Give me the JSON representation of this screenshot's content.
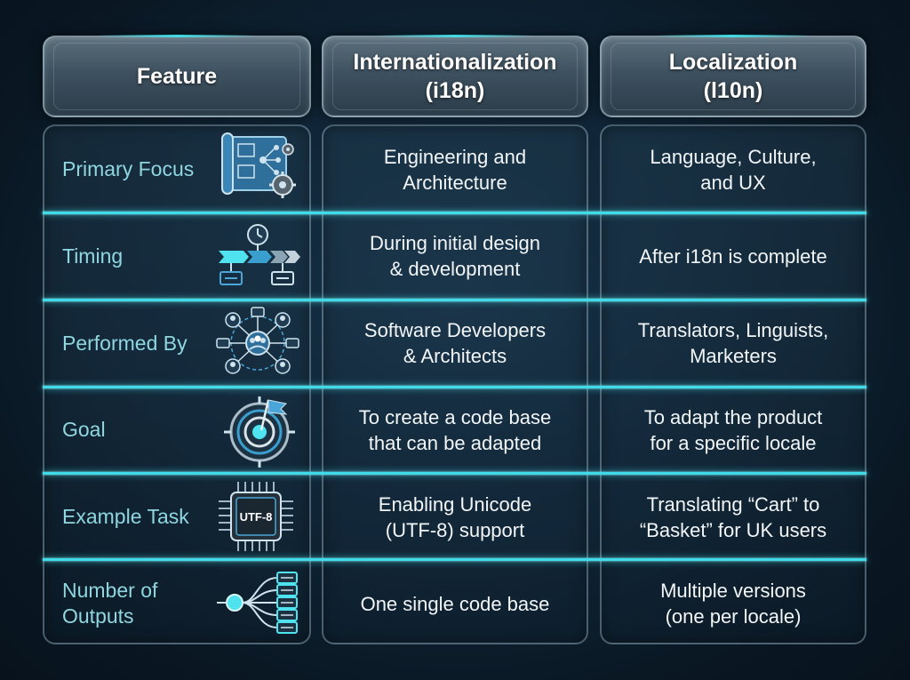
{
  "table": {
    "headers": [
      {
        "title": "Feature",
        "sub": ""
      },
      {
        "title": "Internationalization",
        "sub": "(i18n)"
      },
      {
        "title": "Localization",
        "sub": "(l10n)"
      }
    ],
    "rows": [
      {
        "feature": [
          "Primary Focus",
          ""
        ],
        "icon": "blueprint-gears-icon",
        "i18n": [
          "Engineering and",
          "Architecture"
        ],
        "l10n": [
          "Language, Culture,",
          "and UX"
        ]
      },
      {
        "feature": [
          "Timing",
          ""
        ],
        "icon": "timeline-clock-icon",
        "i18n": [
          "During initial design",
          "& development"
        ],
        "l10n": [
          "After i18n is complete",
          ""
        ]
      },
      {
        "feature": [
          "Performed By",
          ""
        ],
        "icon": "team-network-icon",
        "i18n": [
          "Software Developers",
          "& Architects"
        ],
        "l10n": [
          "Translators, Linguists,",
          "Marketers"
        ]
      },
      {
        "feature": [
          "Goal",
          ""
        ],
        "icon": "target-flag-icon",
        "i18n": [
          "To create a code base",
          "that can be adapted"
        ],
        "l10n": [
          "To adapt the product",
          "for a specific locale"
        ]
      },
      {
        "feature": [
          "Example Task",
          ""
        ],
        "icon": "utf8-chip-icon",
        "icon_text": "UTF-8",
        "i18n": [
          "Enabling Unicode",
          "(UTF-8) support"
        ],
        "l10n": [
          "Translating “Cart” to",
          "“Basket” for UK users"
        ]
      },
      {
        "feature": [
          "Number of",
          "Outputs"
        ],
        "icon": "branching-outputs-icon",
        "i18n": [
          "One single code base",
          ""
        ],
        "l10n": [
          "Multiple versions",
          "(one per locale)"
        ]
      }
    ]
  },
  "colors": {
    "accent": "#3fdbe8",
    "feature_text": "#8fd6e0",
    "body_text": "#f2f6f8",
    "icon_light": "#cfe3ee",
    "icon_blue": "#4aa6d8",
    "icon_cyan": "#4fe3f0"
  }
}
